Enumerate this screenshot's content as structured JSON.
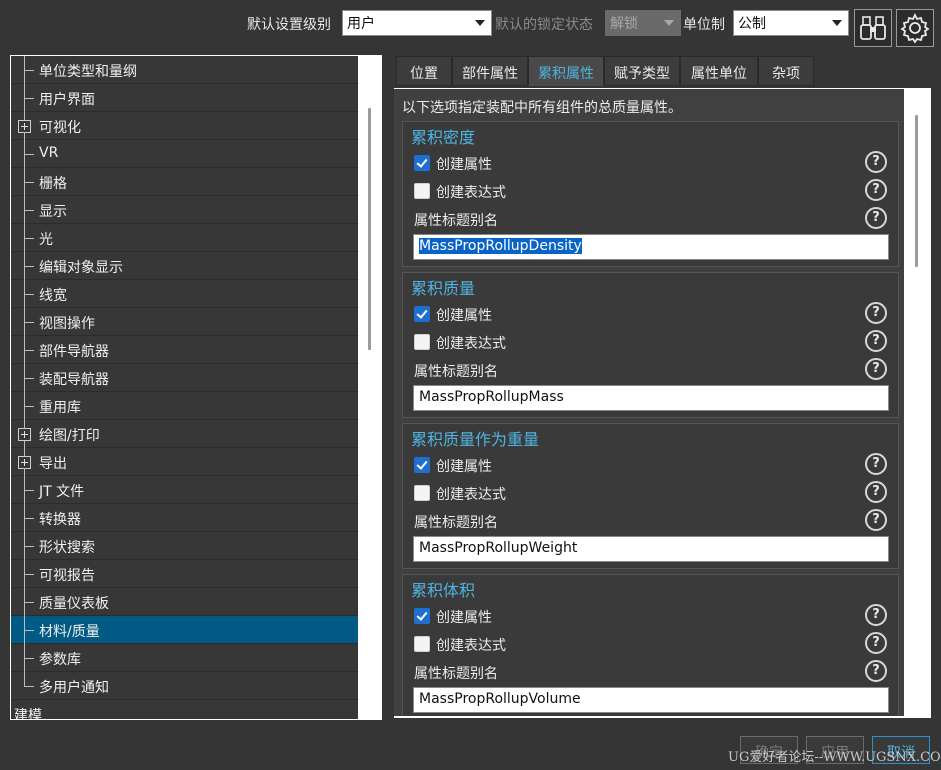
{
  "toolbar": {
    "level_label": "默认设置级别",
    "level_value": "用户",
    "lock_label": "默认的锁定状态",
    "lock_value": "解锁",
    "unit_label": "单位制",
    "unit_value": "公制"
  },
  "tree": {
    "items": [
      {
        "label": "单位类型和量纲",
        "expand": false,
        "selected": false
      },
      {
        "label": "用户界面",
        "expand": false,
        "selected": false
      },
      {
        "label": "可视化",
        "expand": true,
        "selected": false
      },
      {
        "label": "VR",
        "expand": false,
        "selected": false
      },
      {
        "label": "栅格",
        "expand": false,
        "selected": false
      },
      {
        "label": "显示",
        "expand": false,
        "selected": false
      },
      {
        "label": "光",
        "expand": false,
        "selected": false
      },
      {
        "label": "编辑对象显示",
        "expand": false,
        "selected": false
      },
      {
        "label": "线宽",
        "expand": false,
        "selected": false
      },
      {
        "label": "视图操作",
        "expand": false,
        "selected": false
      },
      {
        "label": "部件导航器",
        "expand": false,
        "selected": false
      },
      {
        "label": "装配导航器",
        "expand": false,
        "selected": false
      },
      {
        "label": "重用库",
        "expand": false,
        "selected": false
      },
      {
        "label": "绘图/打印",
        "expand": true,
        "selected": false
      },
      {
        "label": "导出",
        "expand": true,
        "selected": false
      },
      {
        "label": "JT 文件",
        "expand": false,
        "selected": false
      },
      {
        "label": "转换器",
        "expand": false,
        "selected": false
      },
      {
        "label": "形状搜索",
        "expand": false,
        "selected": false
      },
      {
        "label": "可视报告",
        "expand": false,
        "selected": false
      },
      {
        "label": "质量仪表板",
        "expand": false,
        "selected": false
      },
      {
        "label": "材料/质量",
        "expand": false,
        "selected": true
      },
      {
        "label": "参数库",
        "expand": false,
        "selected": false
      },
      {
        "label": "多用户通知",
        "expand": false,
        "selected": false
      }
    ],
    "root_label": "建模"
  },
  "tabs": [
    {
      "label": "位置",
      "active": false
    },
    {
      "label": "部件属性",
      "active": false
    },
    {
      "label": "累积属性",
      "active": true
    },
    {
      "label": "赋予类型",
      "active": false
    },
    {
      "label": "属性单位",
      "active": false
    },
    {
      "label": "杂项",
      "active": false
    }
  ],
  "panel": {
    "intro": "以下选项指定装配中所有组件的总质量属性。",
    "groups": [
      {
        "title": "累积密度",
        "create_attr": "创建属性",
        "create_attr_checked": true,
        "create_expr": "创建表达式",
        "create_expr_checked": false,
        "alias_label": "属性标题别名",
        "alias_value": "MassPropRollupDensity"
      },
      {
        "title": "累积质量",
        "create_attr": "创建属性",
        "create_attr_checked": true,
        "create_expr": "创建表达式",
        "create_expr_checked": false,
        "alias_label": "属性标题别名",
        "alias_value": "MassPropRollupMass"
      },
      {
        "title": "累积质量作为重量",
        "create_attr": "创建属性",
        "create_attr_checked": true,
        "create_expr": "创建表达式",
        "create_expr_checked": false,
        "alias_label": "属性标题别名",
        "alias_value": "MassPropRollupWeight"
      },
      {
        "title": "累积体积",
        "create_attr": "创建属性",
        "create_attr_checked": true,
        "create_expr": "创建表达式",
        "create_expr_checked": false,
        "alias_label": "属性标题别名",
        "alias_value": "MassPropRollupVolume"
      }
    ],
    "help_glyph": "?"
  },
  "buttons": {
    "ok": "确定",
    "apply": "应用",
    "cancel": "取消"
  },
  "watermark": "UG爱好者论坛--WWW.UGSNX.COM",
  "colors": {
    "accent": "#4fb3e0",
    "selection": "#005a84",
    "checkbox": "#1e6fd0",
    "background": "#353535"
  },
  "icons": [
    "binoculars-icon",
    "gear-icon",
    "help-icon",
    "dropdown-arrow-icon",
    "expand-plus-icon"
  ]
}
